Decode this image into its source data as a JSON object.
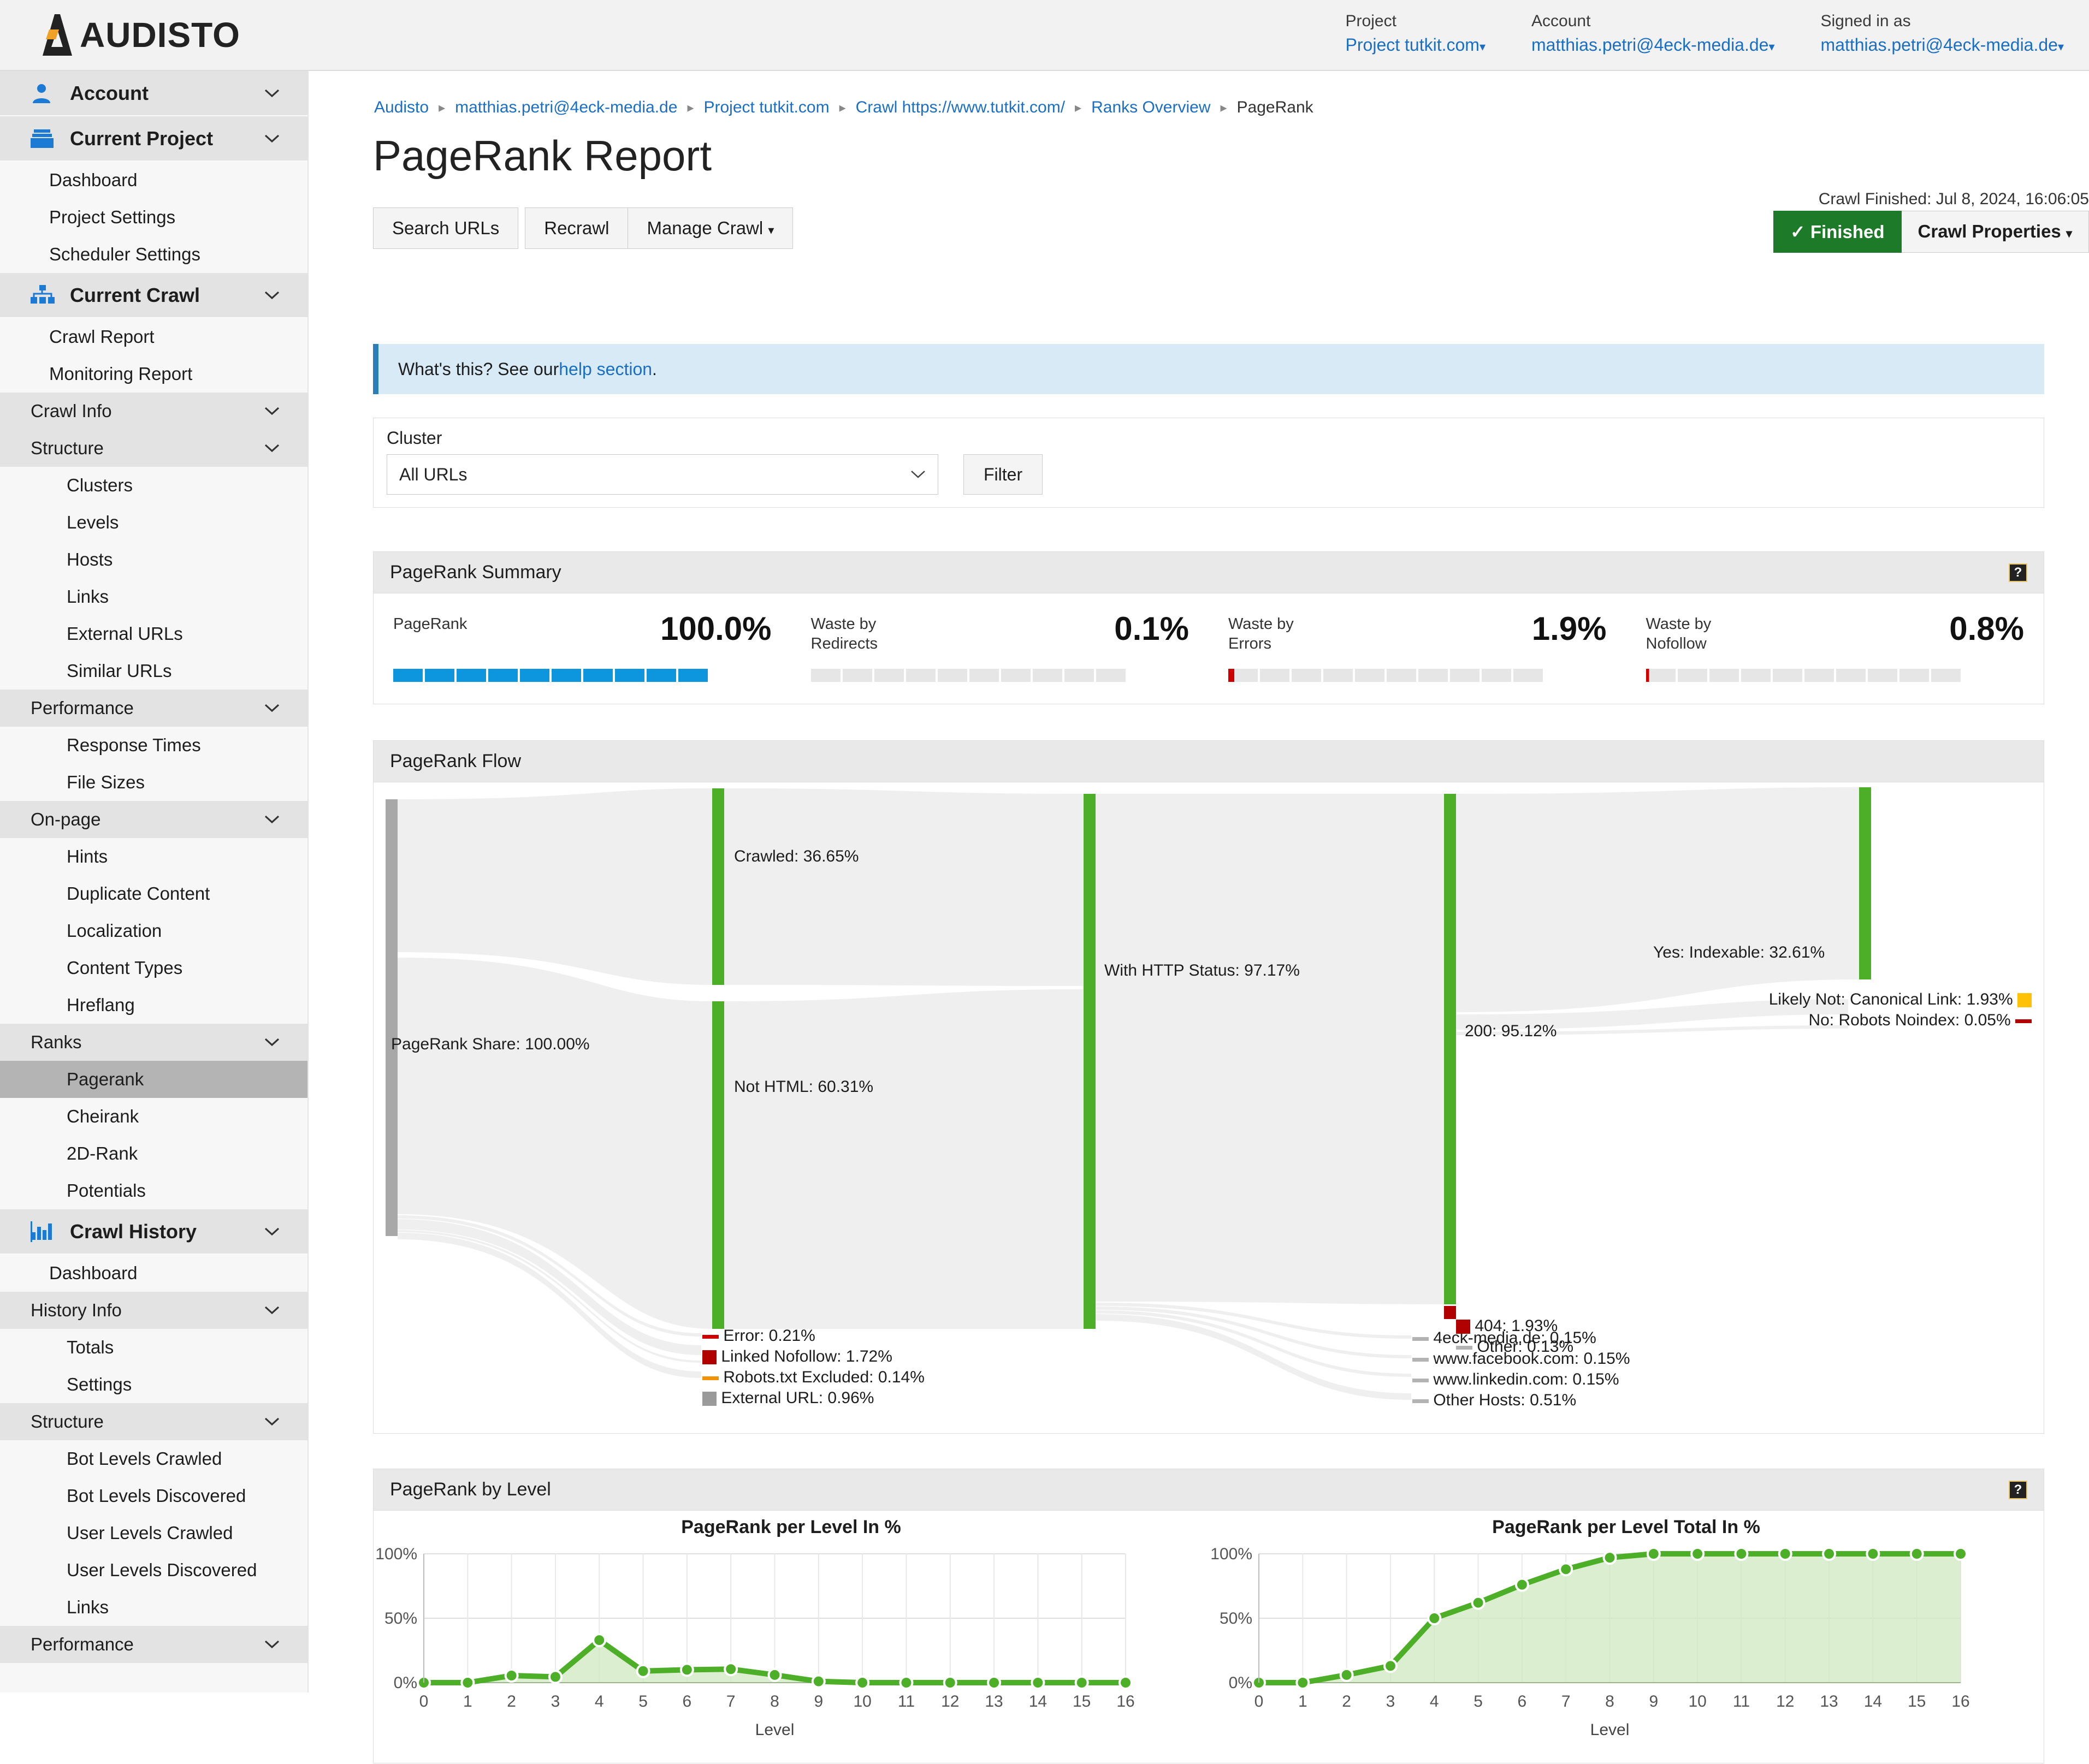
{
  "brand": {
    "name": "AUDISTO"
  },
  "header": {
    "cols": [
      {
        "label": "Project",
        "value": "Project tutkit.com",
        "caret": "▾"
      },
      {
        "label": "Account",
        "value": "matthias.petri@4eck-media.de",
        "caret": "▾"
      },
      {
        "label": "Signed in as",
        "value": "matthias.petri@4eck-media.de",
        "caret": "▾"
      }
    ]
  },
  "sidebar": {
    "sections": [
      {
        "type": "top",
        "label": "Account",
        "icon": "user-icon",
        "chevron": "chevron-down-icon"
      },
      {
        "type": "top",
        "label": "Current Project",
        "icon": "folder-icon",
        "chevron": "chevron-down-icon"
      },
      {
        "type": "item",
        "label": "Dashboard"
      },
      {
        "type": "item",
        "label": "Project Settings"
      },
      {
        "type": "item",
        "label": "Scheduler Settings"
      },
      {
        "type": "top",
        "label": "Current Crawl",
        "icon": "sitemap-icon",
        "chevron": "chevron-down-icon"
      },
      {
        "type": "item",
        "label": "Crawl Report"
      },
      {
        "type": "item",
        "label": "Monitoring Report"
      },
      {
        "type": "grp",
        "label": "Crawl Info"
      },
      {
        "type": "grp",
        "label": "Structure"
      },
      {
        "type": "sub",
        "label": "Clusters"
      },
      {
        "type": "sub",
        "label": "Levels"
      },
      {
        "type": "sub",
        "label": "Hosts"
      },
      {
        "type": "sub",
        "label": "Links"
      },
      {
        "type": "sub",
        "label": "External URLs"
      },
      {
        "type": "sub",
        "label": "Similar URLs"
      },
      {
        "type": "grp",
        "label": "Performance"
      },
      {
        "type": "sub",
        "label": "Response Times"
      },
      {
        "type": "sub",
        "label": "File Sizes"
      },
      {
        "type": "grp",
        "label": "On-page"
      },
      {
        "type": "sub",
        "label": "Hints"
      },
      {
        "type": "sub",
        "label": "Duplicate Content"
      },
      {
        "type": "sub",
        "label": "Localization"
      },
      {
        "type": "sub",
        "label": "Content Types"
      },
      {
        "type": "sub",
        "label": "Hreflang"
      },
      {
        "type": "grp",
        "label": "Ranks"
      },
      {
        "type": "sub",
        "label": "Pagerank",
        "active": true
      },
      {
        "type": "sub",
        "label": "Cheirank"
      },
      {
        "type": "sub",
        "label": "2D-Rank"
      },
      {
        "type": "sub",
        "label": "Potentials"
      },
      {
        "type": "top",
        "label": "Crawl History",
        "icon": "chart-icon",
        "chevron": "chevron-down-icon"
      },
      {
        "type": "item",
        "label": "Dashboard"
      },
      {
        "type": "grp",
        "label": "History Info"
      },
      {
        "type": "sub",
        "label": "Totals"
      },
      {
        "type": "sub",
        "label": "Settings"
      },
      {
        "type": "grp",
        "label": "Structure"
      },
      {
        "type": "sub",
        "label": "Bot Levels Crawled"
      },
      {
        "type": "sub",
        "label": "Bot Levels Discovered"
      },
      {
        "type": "sub",
        "label": "User Levels Crawled"
      },
      {
        "type": "sub",
        "label": "User Levels Discovered"
      },
      {
        "type": "sub",
        "label": "Links"
      },
      {
        "type": "grp",
        "label": "Performance"
      }
    ]
  },
  "breadcrumb": {
    "items": [
      "Audisto",
      "matthias.petri@4eck-media.de",
      "Project tutkit.com",
      "Crawl https://www.tutkit.com/",
      "Ranks Overview",
      "PageRank"
    ],
    "separator": "▸"
  },
  "page": {
    "title": "PageRank Report"
  },
  "toolbar": {
    "search_urls": "Search URLs",
    "recrawl": "Recrawl",
    "manage_crawl": "Manage Crawl",
    "manage_crawl_caret": "▾"
  },
  "status": {
    "crawl_finished": "Crawl Finished: Jul 8, 2024, 16:06:05",
    "finished_label": "Finished",
    "finished_check": "✓",
    "crawl_properties": "Crawl Properties",
    "crawl_properties_caret": "▾",
    "finished_color": "#1d7a29"
  },
  "infobar": {
    "text": "What's this? See our ",
    "link": "help section",
    "suffix": "."
  },
  "filter": {
    "label": "Cluster",
    "selected": "All URLs",
    "chevron": "chevron-down-icon",
    "button": "Filter"
  },
  "summary": {
    "title": "PageRank Summary",
    "help": "?",
    "metrics": [
      {
        "name": "PageRank",
        "value": "100.0%",
        "filled": 10,
        "color": "#0d95de"
      },
      {
        "name": "Waste by\nRedirects",
        "value": "0.1%",
        "filled": 0,
        "color": "#cc0000"
      },
      {
        "name": "Waste by\nErrors",
        "value": "1.9%",
        "filled": 0.2,
        "color": "#cc0000"
      },
      {
        "name": "Waste by\nNofollow",
        "value": "0.8%",
        "filled": 0.1,
        "color": "#cc0000"
      }
    ]
  },
  "flow": {
    "title": "PageRank Flow",
    "source_label": "PageRank Share: 100.00%",
    "nodes": [
      {
        "id": "crawled",
        "label": "Crawled: 36.65%"
      },
      {
        "id": "nothtml",
        "label": "Not HTML: 60.31%"
      },
      {
        "id": "httpstatus",
        "label": "With HTTP Status: 97.17%"
      },
      {
        "id": "status200",
        "label": "200: 95.12%"
      },
      {
        "id": "indexable",
        "label": "Yes: Indexable: 32.61%"
      }
    ],
    "leaf_left": [
      {
        "label": "Error: 0.21%",
        "color": "#cc0000",
        "shape": "dash"
      },
      {
        "label": "Linked Nofollow: 1.72%",
        "color": "#b00000",
        "shape": "block"
      },
      {
        "label": "Robots.txt Excluded: 0.14%",
        "color": "#f0920a",
        "shape": "dash"
      },
      {
        "label": "External URL: 0.96%",
        "color": "#9a9a9a",
        "shape": "block"
      }
    ],
    "leaf_mid": [
      {
        "label": "4eck-media.de: 0.15%",
        "color": "#b3b3b3",
        "shape": "dash"
      },
      {
        "label": "www.facebook.com: 0.15%",
        "color": "#b3b3b3",
        "shape": "dash"
      },
      {
        "label": "www.linkedin.com: 0.15%",
        "color": "#b3b3b3",
        "shape": "dash"
      },
      {
        "label": "Other Hosts: 0.51%",
        "color": "#b3b3b3",
        "shape": "dash"
      }
    ],
    "leaf_status": [
      {
        "label": "404: 1.93%",
        "color": "#b00000",
        "shape": "block"
      },
      {
        "label": "Other: 0.13%",
        "color": "#b3b3b3",
        "shape": "dash"
      }
    ],
    "leaf_index": [
      {
        "label": "Likely Not: Canonical Link: 1.93%",
        "color": "#ffc107",
        "shape": "block"
      },
      {
        "label": "No: Robots Noindex: 0.05%",
        "color": "#b00000",
        "shape": "dash"
      }
    ]
  },
  "levels": {
    "title": "PageRank by Level",
    "help": "?"
  },
  "chart_data": [
    {
      "type": "area",
      "title": "PageRank per Level In %",
      "xlabel": "Level",
      "ylabel": "",
      "x": [
        0,
        1,
        2,
        3,
        4,
        5,
        6,
        7,
        8,
        9,
        10,
        11,
        12,
        13,
        14,
        15,
        16
      ],
      "categories": [
        "0",
        "1",
        "2",
        "3",
        "4",
        "5",
        "6",
        "7",
        "8",
        "9",
        "10",
        "11",
        "12",
        "13",
        "14",
        "15",
        "16"
      ],
      "values": [
        0,
        0,
        5.5,
        4.5,
        33,
        9,
        10,
        10.5,
        6,
        1,
        0,
        0,
        0,
        0,
        0,
        0,
        0
      ],
      "ytick_labels": [
        "0%",
        "50%",
        "100%"
      ],
      "yticks": [
        0,
        50,
        100
      ],
      "ylim": [
        0,
        100
      ],
      "grid": true,
      "legend": "none",
      "line_color": "#4caf27",
      "fill_color": "#cfe8c0"
    },
    {
      "type": "area",
      "title": "PageRank per Level Total In %",
      "xlabel": "Level",
      "ylabel": "",
      "x": [
        0,
        1,
        2,
        3,
        4,
        5,
        6,
        7,
        8,
        9,
        10,
        11,
        12,
        13,
        14,
        15,
        16
      ],
      "categories": [
        "0",
        "1",
        "2",
        "3",
        "4",
        "5",
        "6",
        "7",
        "8",
        "9",
        "10",
        "11",
        "12",
        "13",
        "14",
        "15",
        "16"
      ],
      "values": [
        0,
        0,
        6,
        13,
        50,
        62,
        76,
        88,
        97,
        100,
        100,
        100,
        100,
        100,
        100,
        100,
        100
      ],
      "ytick_labels": [
        "0%",
        "50%",
        "100%"
      ],
      "yticks": [
        0,
        50,
        100
      ],
      "ylim": [
        0,
        100
      ],
      "grid": true,
      "legend": "none",
      "line_color": "#4caf27",
      "fill_color": "#cfe8c0"
    }
  ]
}
